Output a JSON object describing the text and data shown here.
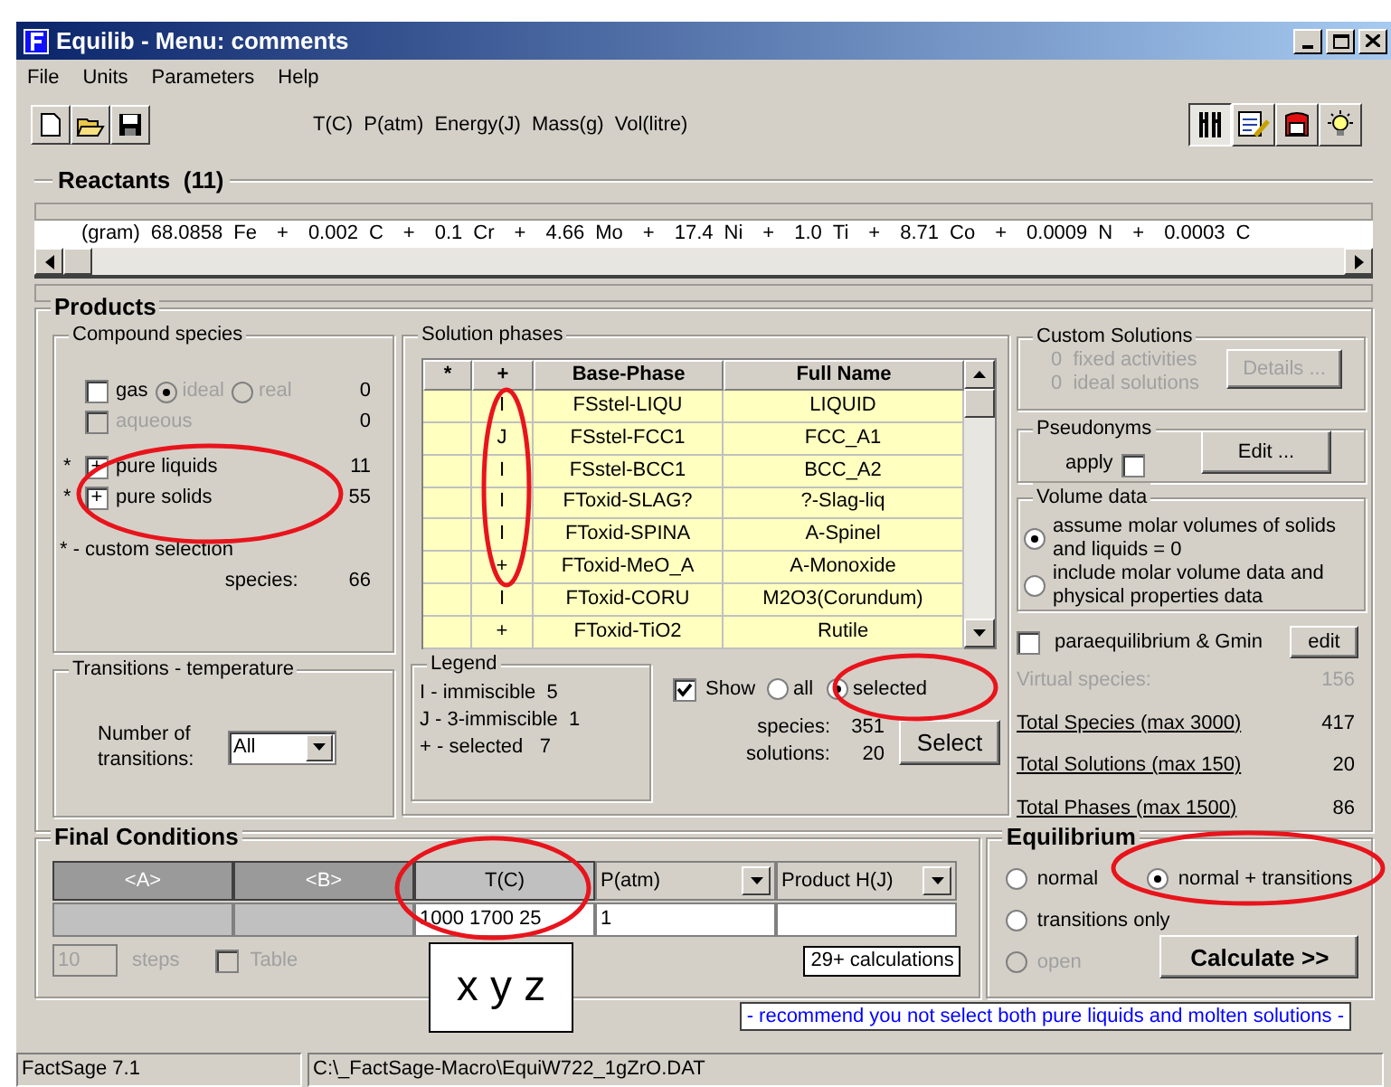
{
  "window": {
    "title": "Equilib - Menu: comments"
  },
  "menu": [
    "File",
    "Units",
    "Parameters",
    "Help"
  ],
  "toolbar": {
    "units": "T(C)  P(atm)  Energy(J)  Mass(g)  Vol(litre)"
  },
  "reactants": {
    "title": "Reactants  (11)",
    "prefix": "(gram)",
    "items": [
      {
        "amount": "68.0858",
        "species": "Fe"
      },
      {
        "amount": "0.002",
        "species": "C"
      },
      {
        "amount": "0.1",
        "species": "Cr"
      },
      {
        "amount": "4.66",
        "species": "Mo"
      },
      {
        "amount": "17.4",
        "species": "Ni"
      },
      {
        "amount": "1.0",
        "species": "Ti"
      },
      {
        "amount": "8.71",
        "species": "Co"
      },
      {
        "amount": "0.0009",
        "species": "N"
      },
      {
        "amount": "0.0003",
        "species": "C"
      }
    ],
    "separator": "+"
  },
  "products": {
    "title": "Products",
    "compound_species": {
      "title": "Compound species",
      "items": [
        {
          "kind": "gas",
          "label": "gas",
          "checked": false,
          "disabled": false,
          "options": [
            {
              "label": "ideal",
              "selected": true
            },
            {
              "label": "real",
              "selected": false
            }
          ],
          "count": "0"
        },
        {
          "kind": "plain",
          "label": "aqueous",
          "checked": false,
          "disabled": true,
          "count": "0"
        },
        {
          "kind": "plain",
          "flag": "*",
          "mark": "+",
          "label": "pure liquids",
          "checked": true,
          "disabled": false,
          "count": "11"
        },
        {
          "kind": "plain",
          "flag": "*",
          "mark": "+",
          "label": "pure solids",
          "checked": true,
          "disabled": false,
          "count": "55"
        }
      ],
      "note": "* - custom selection",
      "species_label": "species:",
      "species_count": "66"
    },
    "transitions": {
      "title": "Transitions - temperature",
      "label": "Number of transitions:",
      "value": "All"
    },
    "solution_phases": {
      "title": "Solution phases",
      "columns": [
        "*",
        "+",
        "Base-Phase",
        "Full Name"
      ],
      "rows": [
        {
          "plus": "I",
          "base": "FSstel-LIQU",
          "full": "LIQUID"
        },
        {
          "plus": "J",
          "base": "FSstel-FCC1",
          "full": "FCC_A1"
        },
        {
          "plus": "I",
          "base": "FSstel-BCC1",
          "full": "BCC_A2"
        },
        {
          "plus": "I",
          "base": "FToxid-SLAG?",
          "full": "?-Slag-liq"
        },
        {
          "plus": "I",
          "base": "FToxid-SPINA",
          "full": "A-Spinel"
        },
        {
          "plus": "+",
          "base": "FToxid-MeO_A",
          "full": "A-Monoxide"
        },
        {
          "plus": "I",
          "base": "FToxid-CORU",
          "full": "M2O3(Corundum)"
        },
        {
          "plus": "+",
          "base": "FToxid-TiO2",
          "full": "Rutile"
        }
      ],
      "legend": {
        "title": "Legend",
        "lines": [
          "I - immiscible  5",
          "J - 3-immiscible  1",
          "+ - selected   7"
        ]
      },
      "show": {
        "label": "Show",
        "checked": true,
        "options": [
          {
            "label": "all",
            "selected": false
          },
          {
            "label": "selected",
            "selected": true
          }
        ]
      },
      "stats": [
        {
          "label": "species:",
          "value": "351"
        },
        {
          "label": "solutions:",
          "value": "20"
        }
      ],
      "select_button": "Select"
    },
    "custom_solutions": {
      "title": "Custom Solutions",
      "lines": [
        "0  fixed activities",
        "0  ideal solutions"
      ],
      "details_button": "Details ..."
    },
    "pseudonyms": {
      "title": "Pseudonyms",
      "apply_label": "apply",
      "apply_checked": false,
      "edit_button": "Edit ..."
    },
    "volume_data": {
      "title": "Volume data",
      "options": [
        {
          "label": "assume molar volumes of solids and liquids = 0",
          "selected": true
        },
        {
          "label": "include molar volume data and physical properties data",
          "selected": false
        }
      ]
    },
    "paraequilibrium": {
      "label": "paraequilibrium & Gmin",
      "checked": false,
      "edit_button": "edit"
    },
    "virtual_species": {
      "label": "Virtual species:",
      "value": "156"
    },
    "totals": [
      {
        "label": "Total Species (max 3000)",
        "value": "417"
      },
      {
        "label": "Total Solutions (max 150)",
        "value": "20"
      },
      {
        "label": "Total Phases (max 1500)",
        "value": "86"
      }
    ]
  },
  "final_conditions": {
    "title": "Final Conditions",
    "columns": [
      {
        "label": "<A>",
        "disabled": true,
        "dropdown": false
      },
      {
        "label": "<B>",
        "disabled": true,
        "dropdown": false
      },
      {
        "label": "T(C)",
        "disabled": false,
        "dropdown": false,
        "value": "1000 1700 25"
      },
      {
        "label": "P(atm)",
        "disabled": false,
        "dropdown": true,
        "value": "1"
      },
      {
        "label": "Product H(J)",
        "disabled": false,
        "dropdown": true
      }
    ],
    "steps_value": "10",
    "steps_label": "steps",
    "table_label": "Table",
    "table_checked": false,
    "calculations": "29+ calculations"
  },
  "equilibrium": {
    "title": "Equilibrium",
    "options": [
      {
        "label": "normal",
        "selected": false,
        "disabled": false
      },
      {
        "label": "normal + transitions",
        "selected": true,
        "disabled": false
      },
      {
        "label": "transitions only",
        "selected": false,
        "disabled": false
      },
      {
        "label": "open",
        "selected": false,
        "disabled": true
      }
    ],
    "calculate_button": "Calculate >>"
  },
  "annotation": {
    "text": "x y z"
  },
  "note": "- recommend you not select both pure liquids and molten solutions -",
  "status_bar": [
    "FactSage 7.1",
    "C:\\_FactSage-Macro\\EquiW722_1gZrO.DAT"
  ]
}
